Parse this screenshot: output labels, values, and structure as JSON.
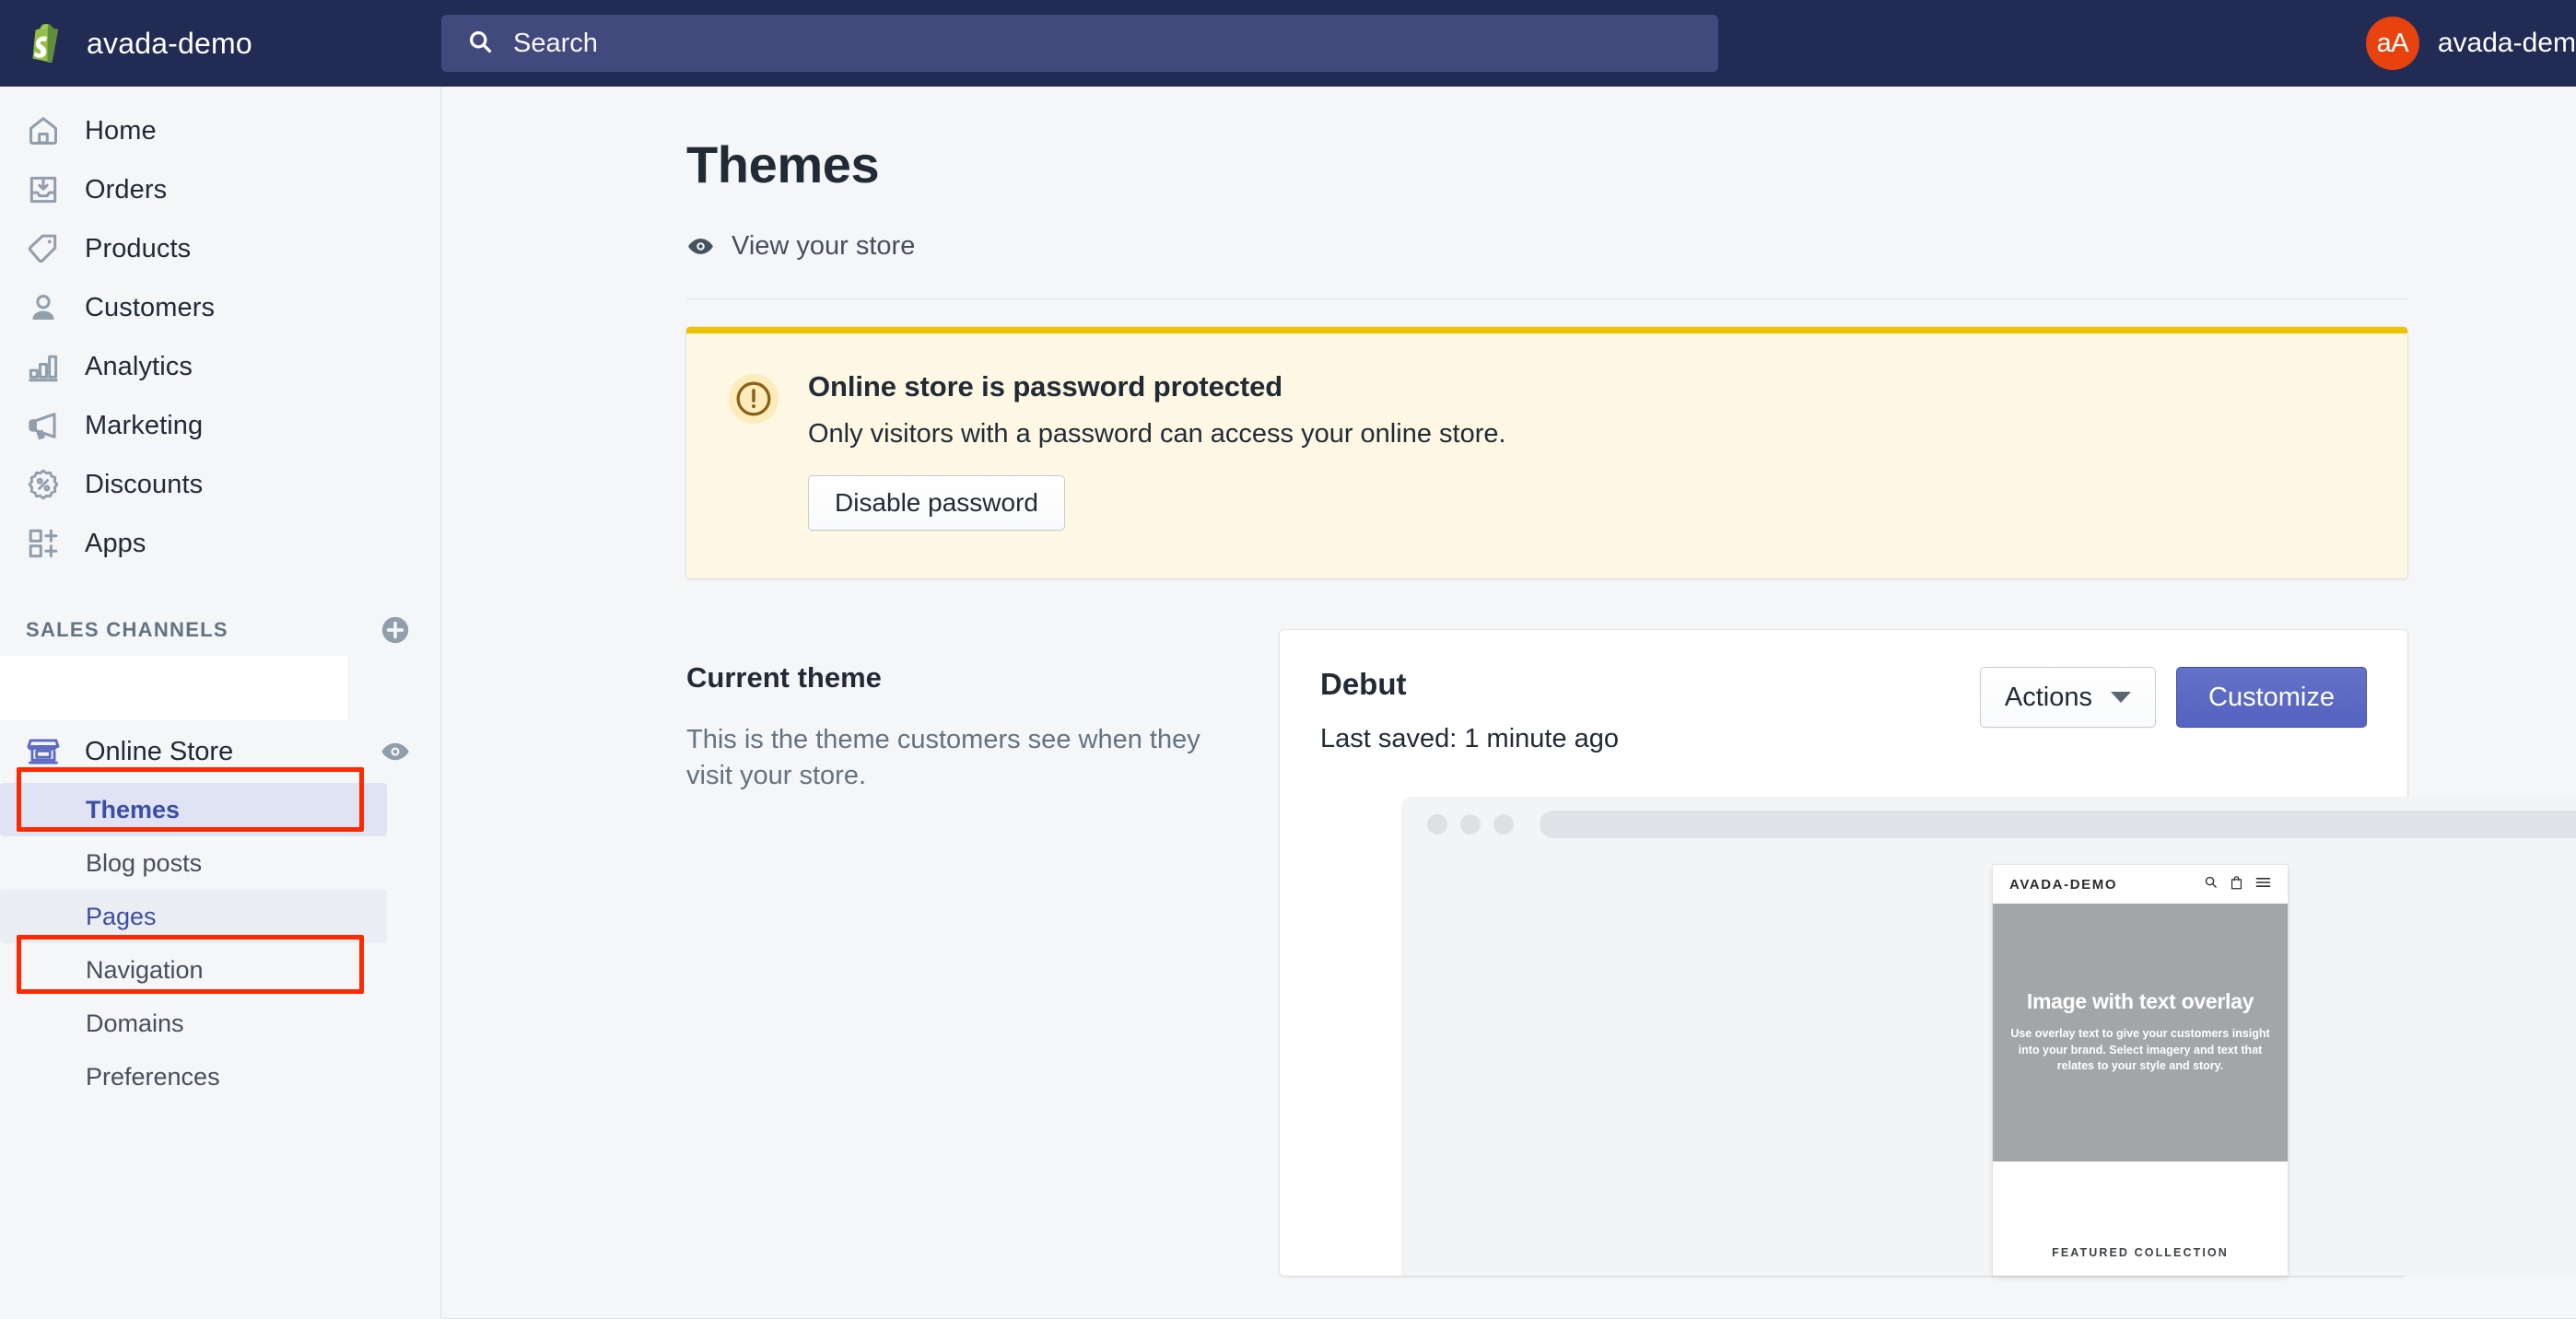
{
  "topbar": {
    "logo_icon": "shopify-bag-icon",
    "store_name": "avada-demo",
    "search": {
      "icon": "search-icon",
      "placeholder": "Search",
      "value": ""
    },
    "user": {
      "avatar_initials": "aA",
      "avatar_color": "#e8420e",
      "name": "avada-demo Ad"
    },
    "bg_color": "#212b54",
    "search_bg_color": "#42497d"
  },
  "sidebar": {
    "nav": [
      {
        "label": "Home",
        "icon": "home-icon"
      },
      {
        "label": "Orders",
        "icon": "orders-inbox-icon"
      },
      {
        "label": "Products",
        "icon": "products-tag-icon"
      },
      {
        "label": "Customers",
        "icon": "customers-person-icon"
      },
      {
        "label": "Analytics",
        "icon": "analytics-bar-chart-icon"
      },
      {
        "label": "Marketing",
        "icon": "marketing-megaphone-icon"
      },
      {
        "label": "Discounts",
        "icon": "discounts-badge-icon"
      },
      {
        "label": "Apps",
        "icon": "apps-grid-plus-icon"
      }
    ],
    "channels_title": "SALES CHANNELS",
    "add_channel_icon": "plus-circle-icon",
    "channel": {
      "label": "Online Store",
      "icon": "online-store-icon",
      "preview_icon": "eye-icon",
      "annotated": true
    },
    "subnav": [
      {
        "label": "Themes",
        "state": "selected"
      },
      {
        "label": "Blog posts",
        "state": "default"
      },
      {
        "label": "Pages",
        "state": "hovered",
        "annotated": true
      },
      {
        "label": "Navigation",
        "state": "default"
      },
      {
        "label": "Domains",
        "state": "default"
      },
      {
        "label": "Preferences",
        "state": "default"
      }
    ],
    "accent_color": "#5c6ac4",
    "annotation_color": "#fb2a00"
  },
  "main": {
    "page_title": "Themes",
    "view_store": {
      "label": "View your store",
      "icon": "eye-icon"
    },
    "banner": {
      "icon": "alert-circle-icon",
      "title": "Online store is password protected",
      "body": "Only visitors with a password can access your online store.",
      "button_label": "Disable password",
      "bg_color": "#fdf7e3",
      "border_color": "#eec200"
    },
    "current_theme": {
      "heading": "Current theme",
      "description": "This is the theme customers see when they visit your store.",
      "theme_name": "Debut",
      "last_saved": "Last saved: 1 minute ago",
      "actions_label": "Actions",
      "actions_caret_icon": "chevron-down-icon",
      "customize_label": "Customize",
      "customize_color": "#5c6ac4"
    },
    "preview": {
      "desktop_mock": {
        "dots": 3,
        "urlbar_value": ""
      },
      "phone_mock": {
        "logo": "AVADA-DEMO",
        "icons": [
          "search-icon",
          "shopping-bag-icon",
          "hamburger-menu-icon"
        ],
        "hero_title": "Image with text overlay",
        "hero_body": "Use overlay text to give your customers insight into your brand. Select imagery and text that relates to your style and story.",
        "featured_label": "FEATURED COLLECTION"
      }
    }
  }
}
